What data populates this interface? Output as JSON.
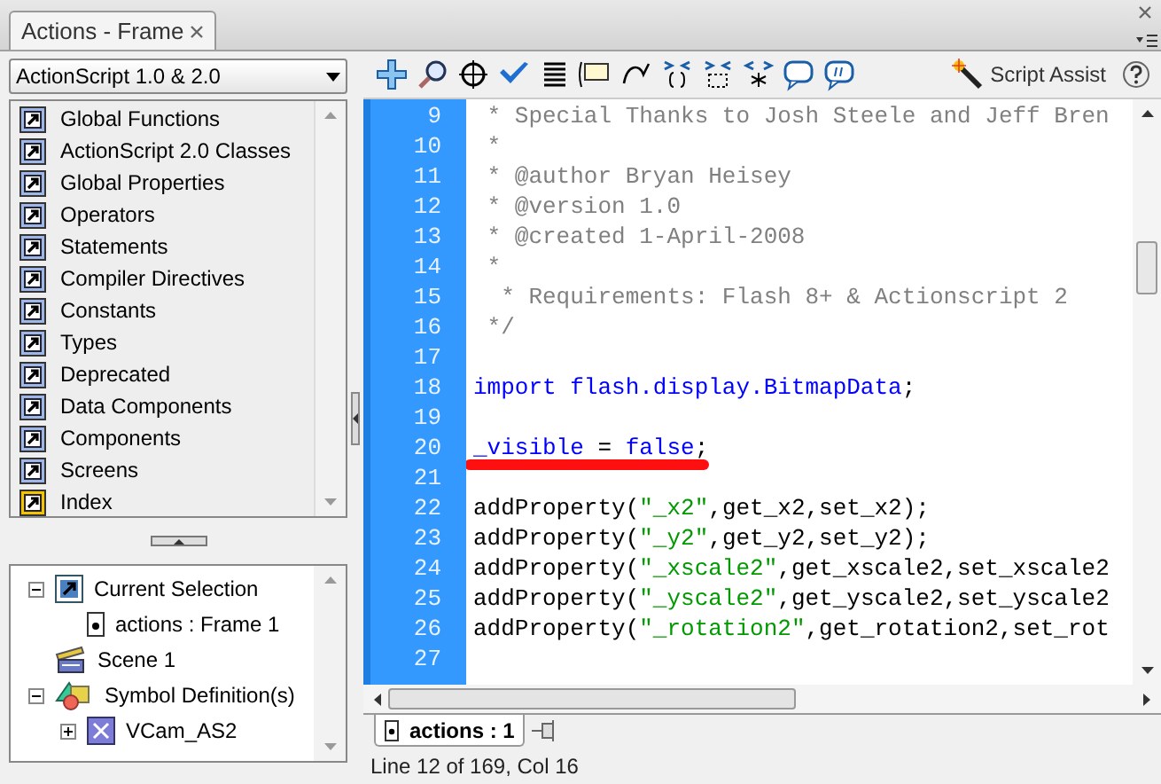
{
  "panel_tab": {
    "title": "Actions - Frame"
  },
  "language_dropdown": {
    "value": "ActionScript 1.0 & 2.0"
  },
  "toolbox": {
    "items": [
      {
        "label": "Global Functions",
        "kind": "book"
      },
      {
        "label": "ActionScript 2.0 Classes",
        "kind": "book"
      },
      {
        "label": "Global Properties",
        "kind": "book"
      },
      {
        "label": "Operators",
        "kind": "book"
      },
      {
        "label": "Statements",
        "kind": "book"
      },
      {
        "label": "Compiler Directives",
        "kind": "book"
      },
      {
        "label": "Constants",
        "kind": "book"
      },
      {
        "label": "Types",
        "kind": "book"
      },
      {
        "label": "Deprecated",
        "kind": "book"
      },
      {
        "label": "Data Components",
        "kind": "book"
      },
      {
        "label": "Components",
        "kind": "book"
      },
      {
        "label": "Screens",
        "kind": "book"
      },
      {
        "label": "Index",
        "kind": "index"
      }
    ]
  },
  "script_navigator": {
    "tree": [
      {
        "label": "Current Selection",
        "kind": "selection",
        "expanded": true,
        "children": [
          {
            "label": "actions : Frame 1",
            "kind": "frame"
          }
        ]
      },
      {
        "label": "Scene 1",
        "kind": "scene"
      },
      {
        "label": "Symbol Definition(s)",
        "kind": "symbols",
        "expanded": true,
        "children": [
          {
            "label": "VCam_AS2",
            "kind": "movieclip",
            "expanded": false
          }
        ]
      }
    ]
  },
  "toolbar": {
    "script_assist": "Script Assist"
  },
  "code": {
    "lines": [
      {
        "number": "9",
        "tokens": [
          {
            "kind": "comment",
            "text": " * Special Thanks to Josh Steele and Jeff Bren"
          }
        ]
      },
      {
        "number": "10",
        "tokens": [
          {
            "kind": "comment",
            "text": " *"
          }
        ]
      },
      {
        "number": "11",
        "tokens": [
          {
            "kind": "comment",
            "text": " * @author Bryan Heisey"
          }
        ]
      },
      {
        "number": "12",
        "tokens": [
          {
            "kind": "comment",
            "text": " * @version 1.0"
          }
        ]
      },
      {
        "number": "13",
        "tokens": [
          {
            "kind": "comment",
            "text": " * @created 1-April-2008"
          }
        ]
      },
      {
        "number": "14",
        "tokens": [
          {
            "kind": "comment",
            "text": " *"
          }
        ]
      },
      {
        "number": "15",
        "tokens": [
          {
            "kind": "comment",
            "text": "  * Requirements: Flash 8+ & Actionscript 2"
          }
        ]
      },
      {
        "number": "16",
        "tokens": [
          {
            "kind": "comment",
            "text": " */"
          }
        ]
      },
      {
        "number": "17"
      },
      {
        "number": "18",
        "tokens": [
          {
            "kind": "keyword",
            "text": "import flash.display.BitmapData"
          },
          {
            "kind": "plain",
            "text": ";"
          }
        ]
      },
      {
        "number": "19"
      },
      {
        "number": "20",
        "tokens": [
          {
            "kind": "keyword",
            "text": "_visible"
          },
          {
            "kind": "plain",
            "text": " = "
          },
          {
            "kind": "keyword",
            "text": "false"
          },
          {
            "kind": "plain",
            "text": ";"
          }
        ],
        "underlined": true
      },
      {
        "number": "21"
      },
      {
        "number": "22",
        "tokens": [
          {
            "kind": "plain",
            "text": "addProperty("
          },
          {
            "kind": "string",
            "text": "\"_x2\""
          },
          {
            "kind": "plain",
            "text": ",get_x2,set_x2);"
          }
        ]
      },
      {
        "number": "23",
        "tokens": [
          {
            "kind": "plain",
            "text": "addProperty("
          },
          {
            "kind": "string",
            "text": "\"_y2\""
          },
          {
            "kind": "plain",
            "text": ",get_y2,set_y2);"
          }
        ]
      },
      {
        "number": "24",
        "tokens": [
          {
            "kind": "plain",
            "text": "addProperty("
          },
          {
            "kind": "string",
            "text": "\"_xscale2\""
          },
          {
            "kind": "plain",
            "text": ",get_xscale2,set_xscale2"
          }
        ]
      },
      {
        "number": "25",
        "tokens": [
          {
            "kind": "plain",
            "text": "addProperty("
          },
          {
            "kind": "string",
            "text": "\"_yscale2\""
          },
          {
            "kind": "plain",
            "text": ",get_yscale2,set_yscale2"
          }
        ]
      },
      {
        "number": "26",
        "tokens": [
          {
            "kind": "plain",
            "text": "addProperty("
          },
          {
            "kind": "string",
            "text": "\"_rotation2\""
          },
          {
            "kind": "plain",
            "text": ",get_rotation2,set_rot"
          }
        ]
      },
      {
        "number": "27"
      }
    ]
  },
  "script_tabs": [
    {
      "label": "actions : 1",
      "selected": true
    }
  ],
  "status_bar": {
    "text": "Line 12 of 169, Col 16"
  }
}
